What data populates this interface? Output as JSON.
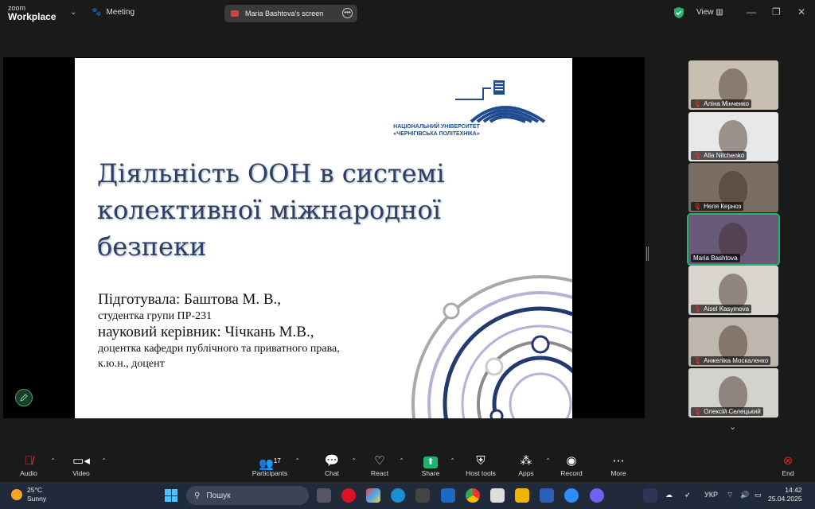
{
  "app": {
    "brand_line1": "zoom",
    "brand_line2": "Workplace",
    "meeting_label": "Meeting",
    "screen_share_label": "Maria Bashtova's screen",
    "view_label": "View"
  },
  "slide": {
    "title": "Діяльність ООН в системі\nколективної міжнародної\nбезпеки",
    "prepared_by": "Підготувала: Баштова М. В.,",
    "student_group": "студентка групи ПР-231",
    "supervisor": "науковий керівник: Чічкань М.В.,",
    "supervisor_role": "доцентка кафедри публічного та приватного права,",
    "supervisor_degree": "к.ю.н., доцент",
    "university_line1": "НАЦІОНАЛЬНИЙ УНІВЕРСИТЕТ",
    "university_line2": "«ЧЕРНІГІВСЬКА ПОЛІТЕХНІКА»"
  },
  "participants": [
    {
      "name": "Аліна Мінченко",
      "muted": true,
      "bg": "#c9bfb0"
    },
    {
      "name": "Alla Nitchenko",
      "muted": true,
      "bg": "#e8e8e8"
    },
    {
      "name": "Неля Керноз",
      "muted": true,
      "bg": "#7a6d62"
    },
    {
      "name": "Maria Bashtova",
      "muted": false,
      "bg": "#6a5a7a",
      "active": true
    },
    {
      "name": "Aisel Kasymova",
      "muted": true,
      "bg": "#d8d4ce"
    },
    {
      "name": "Анжеліка Москаленко",
      "muted": true,
      "bg": "#bfb7ae"
    },
    {
      "name": "Олексій Селецький",
      "muted": true,
      "bg": "#d4d2cc"
    }
  ],
  "toolbar": {
    "audio": "Audio",
    "video": "Video",
    "participants": "Participants",
    "participants_count": "17",
    "chat": "Chat",
    "react": "React",
    "share": "Share",
    "host_tools": "Host tools",
    "apps": "Apps",
    "record": "Record",
    "more": "More",
    "end": "End"
  },
  "taskbar": {
    "temperature": "25°C",
    "weather": "Sunny",
    "search_placeholder": "Пошук",
    "language": "УКР",
    "time": "14:42",
    "date": "25.04.2025"
  },
  "colors": {
    "accent_green": "#27b36b",
    "end_red": "#e02020",
    "slide_title": "#2d3f66"
  }
}
